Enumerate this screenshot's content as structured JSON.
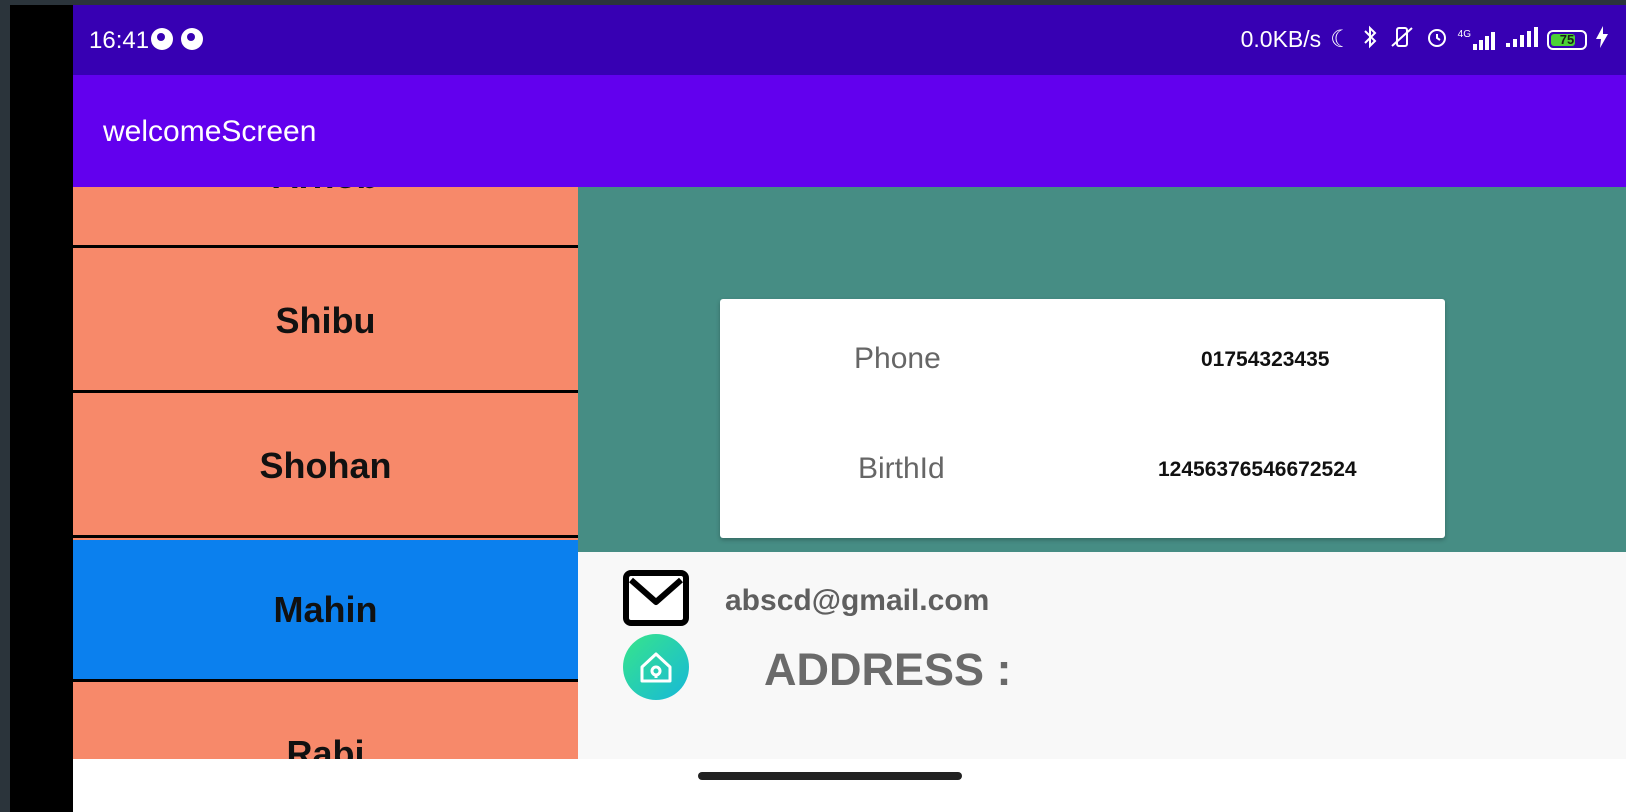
{
  "status_bar": {
    "time": "16:41",
    "network_speed": "0.0KB/s",
    "signal_label": "4G",
    "battery_level": "75",
    "icons": [
      "notification-icon",
      "notification-icon",
      "moon-icon",
      "bluetooth-icon",
      "vibrate-off-icon",
      "alarm-icon",
      "signal-4g-icon",
      "signal-icon",
      "battery-icon",
      "charging-icon"
    ]
  },
  "app_bar": {
    "title": "welcomeScreen"
  },
  "list": {
    "items": [
      {
        "name": "Arnob"
      },
      {
        "name": "Shibu"
      },
      {
        "name": "Shohan"
      },
      {
        "name": "Mahin",
        "selected": true
      },
      {
        "name": "Rabi"
      }
    ]
  },
  "details": {
    "phone_label": "Phone",
    "phone_value": "01754323435",
    "birthid_label": "BirthId",
    "birthid_value": "12456376546672524",
    "email": "abscd@gmail.com",
    "address_label": "ADDRESS :"
  },
  "colors": {
    "status_bar": "#3700b3",
    "app_bar": "#6200ee",
    "list_item": "#f7896a",
    "list_item_selected": "#0b80ee",
    "teal_panel": "#468d84"
  }
}
